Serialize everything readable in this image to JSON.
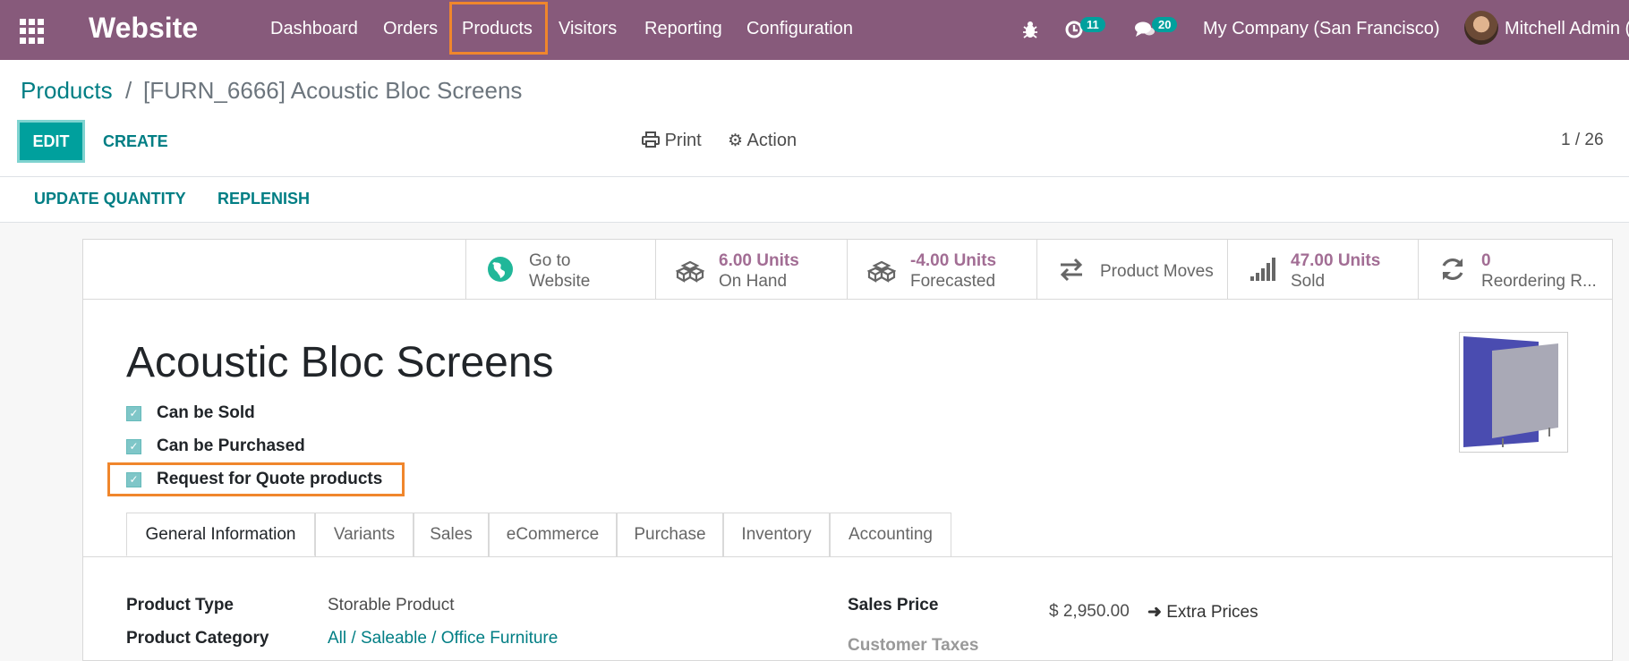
{
  "navbar": {
    "brand": "Website",
    "menu": [
      "Dashboard",
      "Orders",
      "Products",
      "Visitors",
      "Reporting",
      "Configuration"
    ],
    "activities_count": "11",
    "messages_count": "20",
    "company": "My Company (San Francisco)",
    "user": "Mitchell Admin (",
    "highlight_color": "#f0862c",
    "brand_color": "#875a7b"
  },
  "breadcrumb": {
    "parent": "Products",
    "separator": "/",
    "current": "[FURN_6666] Acoustic Bloc Screens"
  },
  "control": {
    "edit": "EDIT",
    "create": "CREATE",
    "print": "Print",
    "action": "Action",
    "pager": "1 / 26"
  },
  "header_buttons": {
    "update_quantity": "UPDATE QUANTITY",
    "replenish": "REPLENISH"
  },
  "smart_buttons": {
    "website": {
      "line1": "Go to",
      "line2": "Website",
      "icon": "globe-icon"
    },
    "on_hand": {
      "value": "6.00 Units",
      "label": "On Hand",
      "icon": "cubes-icon"
    },
    "forecasted": {
      "value": "-4.00 Units",
      "label": "Forecasted",
      "icon": "cubes-icon"
    },
    "moves": {
      "label": "Product Moves",
      "icon": "exchange-icon"
    },
    "sold": {
      "value": "47.00 Units",
      "label": "Sold",
      "icon": "signal-icon"
    },
    "reordering": {
      "value": "0",
      "label": "Reordering R...",
      "icon": "refresh-icon"
    }
  },
  "product": {
    "name": "Acoustic Bloc Screens",
    "can_be_sold": "Can be Sold",
    "can_be_purchased": "Can be Purchased",
    "rfq": "Request for Quote products"
  },
  "tabs": [
    "General Information",
    "Variants",
    "Sales",
    "eCommerce",
    "Purchase",
    "Inventory",
    "Accounting"
  ],
  "fields": {
    "product_type_label": "Product Type",
    "product_type": "Storable Product",
    "product_category_label": "Product Category",
    "product_category": "All / Saleable / Office Furniture",
    "sales_price_label": "Sales Price",
    "sales_price": "$ 2,950.00",
    "extra_prices": "Extra Prices",
    "customer_taxes_label": "Customer Taxes"
  }
}
